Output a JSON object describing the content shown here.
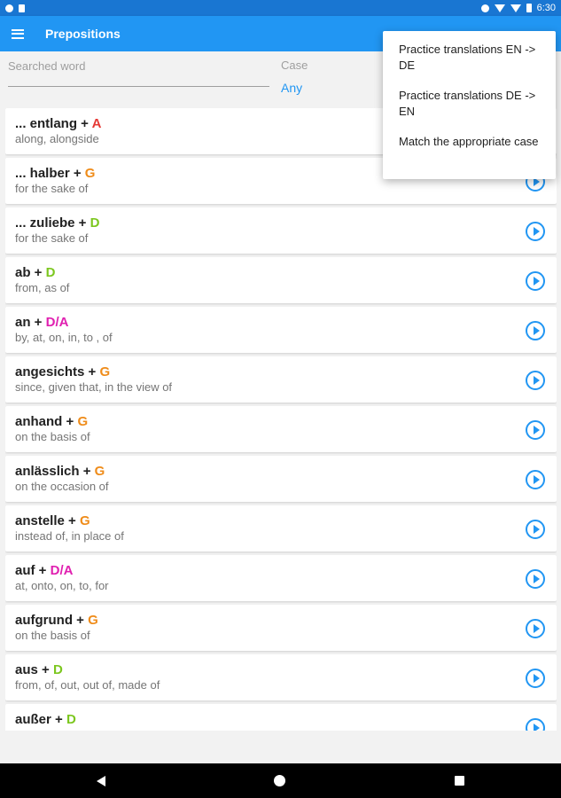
{
  "status_bar": {
    "time": "6:30"
  },
  "app_bar": {
    "title": "Prepositions"
  },
  "filters": {
    "search_placeholder": "Searched word",
    "case_label": "Case",
    "case_value": "Any"
  },
  "case_colors": {
    "A": "#e53935",
    "G": "#ef8c1a",
    "D": "#7cc71f",
    "D/A": "#e020b0"
  },
  "prepositions": [
    {
      "word": "... entlang",
      "case": "A",
      "translation": "along, alongside"
    },
    {
      "word": "... halber",
      "case": "G",
      "translation": "for the sake of"
    },
    {
      "word": "... zuliebe",
      "case": "D",
      "translation": "for the sake of"
    },
    {
      "word": "ab",
      "case": "D",
      "translation": "from, as of"
    },
    {
      "word": "an",
      "case": "D/A",
      "translation": "by, at, on, in, to , of"
    },
    {
      "word": "angesichts",
      "case": "G",
      "translation": "since, given that, in the view of"
    },
    {
      "word": "anhand",
      "case": "G",
      "translation": "on the basis of"
    },
    {
      "word": "anlässlich",
      "case": "G",
      "translation": "on the occasion of"
    },
    {
      "word": "anstelle",
      "case": "G",
      "translation": "instead of, in place of"
    },
    {
      "word": "auf",
      "case": "D/A",
      "translation": "at, onto, on, to, for"
    },
    {
      "word": "aufgrund",
      "case": "G",
      "translation": "on the basis of"
    },
    {
      "word": "aus",
      "case": "D",
      "translation": "from, of, out, out of, made of"
    },
    {
      "word": "außer",
      "case": "D",
      "translation": ""
    }
  ],
  "popup_menu": {
    "items": [
      "Practice translations EN -> DE",
      "Practice translations DE -> EN",
      "Match the appropriate case"
    ]
  }
}
